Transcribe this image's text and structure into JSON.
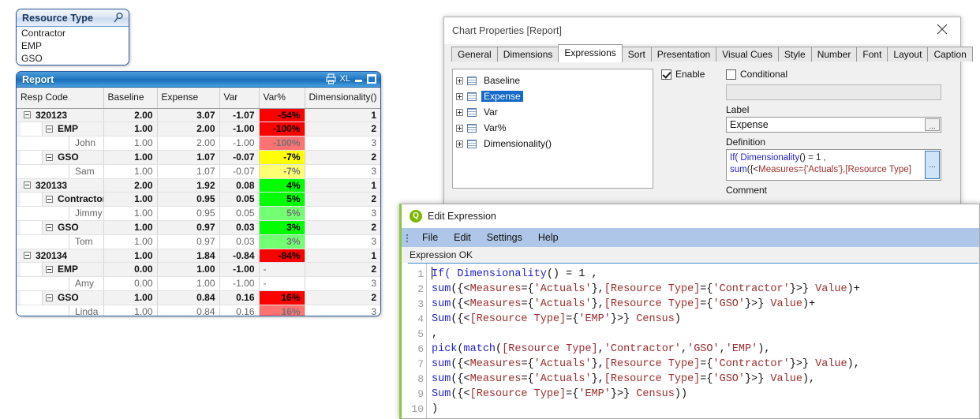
{
  "listbox": {
    "title": "Resource Type",
    "search_icon": "search-icon",
    "items": [
      "Contractor",
      "EMP",
      "GSO"
    ]
  },
  "report": {
    "caption": "Report",
    "caption_icons": [
      "print-icon",
      "XL",
      "minimize-icon",
      "maximize-icon"
    ],
    "xl_label": "XL",
    "columns": [
      "Resp Code",
      "Baseline",
      "Expense",
      "Var",
      "Var%",
      "Dimensionality()"
    ],
    "rows": [
      {
        "level": 1,
        "label": "320123",
        "baseline": "2.00",
        "expense": "3.07",
        "var": "-1.07",
        "varpct": "-54%",
        "varpct_color": "#FF0000",
        "dim": "1"
      },
      {
        "level": 2,
        "label": "EMP",
        "baseline": "1.00",
        "expense": "2.00",
        "var": "-1.00",
        "varpct": "-100%",
        "varpct_color": "#FF0000",
        "dim": "2"
      },
      {
        "level": 3,
        "label": "John",
        "baseline": "1.00",
        "expense": "2.00",
        "var": "-1.00",
        "varpct": "-100%",
        "varpct_color": "#FF0000",
        "dim": "3"
      },
      {
        "level": 2,
        "label": "GSO",
        "baseline": "1.00",
        "expense": "1.07",
        "var": "-0.07",
        "varpct": "-7%",
        "varpct_color": "#FFFF00",
        "dim": "2"
      },
      {
        "level": 3,
        "label": "Sam",
        "baseline": "1.00",
        "expense": "1.07",
        "var": "-0.07",
        "varpct": "-7%",
        "varpct_color": "#FFFF00",
        "dim": "3"
      },
      {
        "level": 1,
        "label": "320133",
        "baseline": "2.00",
        "expense": "1.92",
        "var": "0.08",
        "varpct": "4%",
        "varpct_color": "#00FF00",
        "dim": "1"
      },
      {
        "level": 2,
        "label": "Contractor",
        "baseline": "1.00",
        "expense": "0.95",
        "var": "0.05",
        "varpct": "5%",
        "varpct_color": "#00FF00",
        "dim": "2"
      },
      {
        "level": 3,
        "label": "Jimmy",
        "baseline": "1.00",
        "expense": "0.95",
        "var": "0.05",
        "varpct": "5%",
        "varpct_color": "#00FF00",
        "dim": "3"
      },
      {
        "level": 2,
        "label": "GSO",
        "baseline": "1.00",
        "expense": "0.97",
        "var": "0.03",
        "varpct": "3%",
        "varpct_color": "#00FF00",
        "dim": "2"
      },
      {
        "level": 3,
        "label": "Tom",
        "baseline": "1.00",
        "expense": "0.97",
        "var": "0.03",
        "varpct": "3%",
        "varpct_color": "#00FF00",
        "dim": "3"
      },
      {
        "level": 1,
        "label": "320134",
        "baseline": "1.00",
        "expense": "1.84",
        "var": "-0.84",
        "varpct": "-84%",
        "varpct_color": "#FF0000",
        "dim": "1"
      },
      {
        "level": 2,
        "label": "EMP",
        "baseline": "0.00",
        "expense": "1.00",
        "var": "-1.00",
        "varpct": "-",
        "varpct_color": "",
        "dim": "2"
      },
      {
        "level": 3,
        "label": "Amy",
        "baseline": "0.00",
        "expense": "1.00",
        "var": "-1.00",
        "varpct": "-",
        "varpct_color": "",
        "dim": "3"
      },
      {
        "level": 2,
        "label": "GSO",
        "baseline": "1.00",
        "expense": "0.84",
        "var": "0.16",
        "varpct": "16%",
        "varpct_color": "#FF0000",
        "dim": "2"
      },
      {
        "level": 3,
        "label": "Linda",
        "baseline": "1.00",
        "expense": "0.84",
        "var": "0.16",
        "varpct": "16%",
        "varpct_color": "#FF0000",
        "dim": "3"
      }
    ]
  },
  "chart_properties": {
    "title": "Chart Properties [Report]",
    "close_icon": "close-icon",
    "tabs": [
      "General",
      "Dimensions",
      "Expressions",
      "Sort",
      "Presentation",
      "Visual Cues",
      "Style",
      "Number",
      "Font",
      "Layout",
      "Caption"
    ],
    "active_tab": "Expressions",
    "expressions": [
      {
        "label": "Baseline",
        "selected": false
      },
      {
        "label": "Expense",
        "selected": true
      },
      {
        "label": "Var",
        "selected": false
      },
      {
        "label": "Var%",
        "selected": false
      },
      {
        "label": "Dimensionality()",
        "selected": false
      }
    ],
    "enable_label": "Enable",
    "enable_checked": true,
    "conditional_label": "Conditional",
    "conditional_checked": false,
    "conditional_value": "",
    "label_caption": "Label",
    "label_value": "Expense",
    "definition_caption": "Definition",
    "definition_line1_a": "If(",
    "definition_line1_b": " Dimensionality",
    "definition_line1_c": "() = 1 ,",
    "definition_line2_a": "sum",
    "definition_line2_b": "({<",
    "definition_line2_c": "Measures",
    "definition_line2_d": "={'Actuals'}",
    "definition_line2_e": ",[Resource Type]",
    "comment_caption": "Comment",
    "ellipsis_label": "..."
  },
  "edit_expression": {
    "title": "Edit Expression",
    "logo_icon": "qlik-logo-icon",
    "logo_glyph": "Q",
    "menu": [
      "File",
      "Edit",
      "Settings",
      "Help"
    ],
    "status": "Expression OK",
    "line_numbers": [
      "1",
      "2",
      "3",
      "4",
      "5",
      "6",
      "7",
      "8",
      "9",
      "10"
    ],
    "code_lines": [
      [
        {
          "t": "If( ",
          "c": "fn"
        },
        {
          "t": "Dimensionality",
          "c": "fn"
        },
        {
          "t": "() = 1 ,",
          "c": "txt"
        }
      ],
      [
        {
          "t": "sum",
          "c": "fn"
        },
        {
          "t": "({<",
          "c": "txt"
        },
        {
          "t": "Measures",
          "c": "fld"
        },
        {
          "t": "={",
          "c": "txt"
        },
        {
          "t": "'Actuals'",
          "c": "str"
        },
        {
          "t": "},",
          "c": "txt"
        },
        {
          "t": "[Resource Type]",
          "c": "fld"
        },
        {
          "t": "={",
          "c": "txt"
        },
        {
          "t": "'Contractor'",
          "c": "str"
        },
        {
          "t": "}>} ",
          "c": "txt"
        },
        {
          "t": "Value",
          "c": "fld"
        },
        {
          "t": ")+",
          "c": "txt"
        }
      ],
      [
        {
          "t": "sum",
          "c": "fn"
        },
        {
          "t": "({<",
          "c": "txt"
        },
        {
          "t": "Measures",
          "c": "fld"
        },
        {
          "t": "={",
          "c": "txt"
        },
        {
          "t": "'Actuals'",
          "c": "str"
        },
        {
          "t": "},",
          "c": "txt"
        },
        {
          "t": "[Resource Type]",
          "c": "fld"
        },
        {
          "t": "={",
          "c": "txt"
        },
        {
          "t": "'GSO'",
          "c": "str"
        },
        {
          "t": "}>} ",
          "c": "txt"
        },
        {
          "t": "Value",
          "c": "fld"
        },
        {
          "t": ")+",
          "c": "txt"
        }
      ],
      [
        {
          "t": "Sum",
          "c": "fn"
        },
        {
          "t": "({<",
          "c": "txt"
        },
        {
          "t": "[Resource Type]",
          "c": "fld"
        },
        {
          "t": "={",
          "c": "txt"
        },
        {
          "t": "'EMP'",
          "c": "str"
        },
        {
          "t": "}>} ",
          "c": "txt"
        },
        {
          "t": "Census",
          "c": "fld"
        },
        {
          "t": ")",
          "c": "txt"
        }
      ],
      [
        {
          "t": ",",
          "c": "txt"
        }
      ],
      [
        {
          "t": "pick",
          "c": "fn"
        },
        {
          "t": "(",
          "c": "txt"
        },
        {
          "t": "match",
          "c": "fn"
        },
        {
          "t": "(",
          "c": "txt"
        },
        {
          "t": "[Resource Type]",
          "c": "fld"
        },
        {
          "t": ",",
          "c": "txt"
        },
        {
          "t": "'Contractor'",
          "c": "str"
        },
        {
          "t": ",",
          "c": "txt"
        },
        {
          "t": "'GSO'",
          "c": "str"
        },
        {
          "t": ",",
          "c": "txt"
        },
        {
          "t": "'EMP'",
          "c": "str"
        },
        {
          "t": "),",
          "c": "txt"
        }
      ],
      [
        {
          "t": "sum",
          "c": "fn"
        },
        {
          "t": "({<",
          "c": "txt"
        },
        {
          "t": "Measures",
          "c": "fld"
        },
        {
          "t": "={",
          "c": "txt"
        },
        {
          "t": "'Actuals'",
          "c": "str"
        },
        {
          "t": "},",
          "c": "txt"
        },
        {
          "t": "[Resource Type]",
          "c": "fld"
        },
        {
          "t": "={",
          "c": "txt"
        },
        {
          "t": "'Contractor'",
          "c": "str"
        },
        {
          "t": "}>} ",
          "c": "txt"
        },
        {
          "t": "Value",
          "c": "fld"
        },
        {
          "t": "),",
          "c": "txt"
        }
      ],
      [
        {
          "t": "sum",
          "c": "fn"
        },
        {
          "t": "({<",
          "c": "txt"
        },
        {
          "t": "Measures",
          "c": "fld"
        },
        {
          "t": "={",
          "c": "txt"
        },
        {
          "t": "'Actuals'",
          "c": "str"
        },
        {
          "t": "},",
          "c": "txt"
        },
        {
          "t": "[Resource Type]",
          "c": "fld"
        },
        {
          "t": "={",
          "c": "txt"
        },
        {
          "t": "'GSO'",
          "c": "str"
        },
        {
          "t": "}>} ",
          "c": "txt"
        },
        {
          "t": "Value",
          "c": "fld"
        },
        {
          "t": "),",
          "c": "txt"
        }
      ],
      [
        {
          "t": "Sum",
          "c": "fn"
        },
        {
          "t": "({<",
          "c": "txt"
        },
        {
          "t": "[Resource Type]",
          "c": "fld"
        },
        {
          "t": "={",
          "c": "txt"
        },
        {
          "t": "'EMP'",
          "c": "str"
        },
        {
          "t": "}>} ",
          "c": "txt"
        },
        {
          "t": "Census",
          "c": "fld"
        },
        {
          "t": "))",
          "c": "txt"
        }
      ],
      [
        {
          "t": ")",
          "c": "txt"
        }
      ]
    ]
  },
  "colors": {
    "red": "#FF0000",
    "yellow": "#FFFF00",
    "green": "#00FF00",
    "selection_blue": "#1569C7",
    "caption_blue": "#2277C2",
    "qlik_green": "#7AB800"
  }
}
